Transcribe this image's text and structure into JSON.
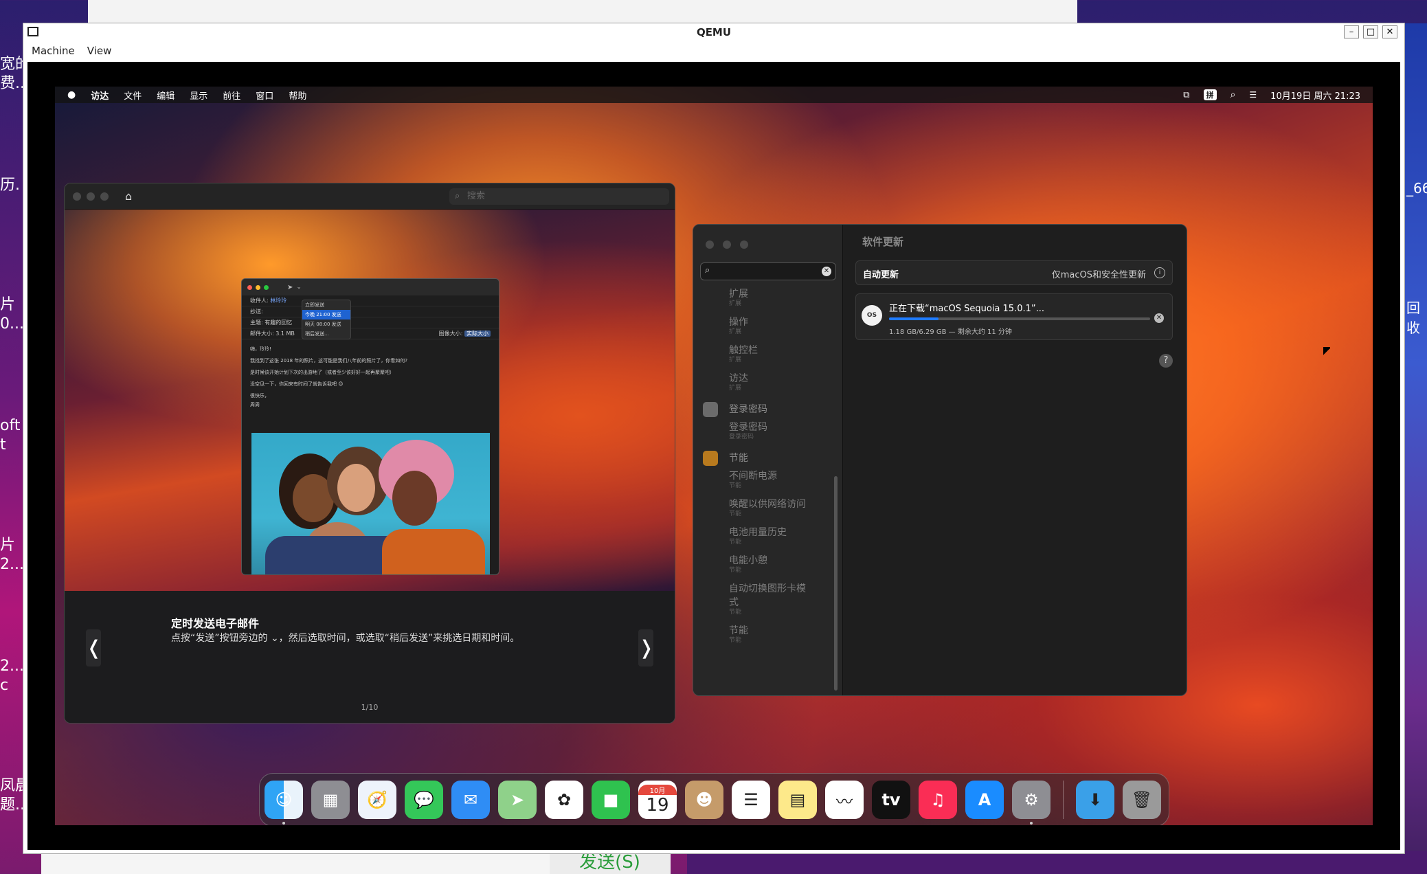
{
  "host": {
    "left_texts": [
      "宽的",
      "费...",
      "历.",
      "片",
      "0...",
      "oft",
      "t",
      "片",
      "2...",
      "2...",
      "c",
      "凤晨",
      "题..."
    ],
    "right_texts": [
      "_66",
      "回收"
    ],
    "send_button": "发送(S)"
  },
  "qemu": {
    "title": "QEMU",
    "menu": [
      "Machine",
      "View"
    ],
    "btn_min": "–",
    "btn_max": "□",
    "btn_close": "✕"
  },
  "mac": {
    "menubar": {
      "apple": "",
      "app_name": "访达",
      "items": [
        "文件",
        "编辑",
        "显示",
        "前往",
        "窗口",
        "帮助"
      ],
      "input_method": "拼",
      "datetime": "10月19日 周六 21:23"
    },
    "tips": {
      "search_placeholder": "搜索",
      "mail": {
        "to_label": "收件人:",
        "to_value": "林玲玲",
        "cc_label": "抄送:",
        "subject_label": "主题:",
        "subject_value": "有趣的回忆",
        "size_label": "邮件大小: 3.1 MB",
        "image_size_label": "图像大小:",
        "image_size_value": "实际大小",
        "menu_items": [
          "立即发送",
          "今晚 21:00 发送",
          "明天 08:00 发送",
          "稍后发送..."
        ],
        "body": [
          "嗨，玲玲!",
          "我找到了这张 2018 年的照片，这可能是我们八年前的照片了，你看如何?",
          "是时候该开始计划下次的出游地了（或者至少该好好一起再聚聚吧）",
          "没空见一下，你回来有时间了就告诉我吧 😊",
          "很快乐，",
          "周周"
        ]
      },
      "title": "定时发送电子邮件",
      "description": "点按“发送”按钮旁边的 ⌄，然后选取时间，或选取“稍后发送”来挑选日期和时间。",
      "prev": "❬",
      "next": "❭",
      "page": "1/10"
    },
    "settings": {
      "search_value": "",
      "sidebar": [
        {
          "type": "item",
          "label": "扩展",
          "sub": "扩展"
        },
        {
          "type": "item",
          "label": "操作",
          "sub": "扩展"
        },
        {
          "type": "item",
          "label": "触控栏",
          "sub": "扩展"
        },
        {
          "type": "item",
          "label": "访达",
          "sub": "扩展"
        },
        {
          "type": "head",
          "label": "登录密码",
          "color": "#6b6b6b"
        },
        {
          "type": "item",
          "label": "登录密码",
          "sub": "登录密码"
        },
        {
          "type": "head",
          "label": "节能",
          "color": "#b87a1e"
        },
        {
          "type": "item",
          "label": "不间断电源",
          "sub": "节能"
        },
        {
          "type": "item",
          "label": "唤醒以供网络访问",
          "sub": "节能"
        },
        {
          "type": "item",
          "label": "电池用量历史",
          "sub": "节能"
        },
        {
          "type": "item",
          "label": "电能小憩",
          "sub": "节能"
        },
        {
          "type": "item",
          "label": "自动切换图形卡模式",
          "sub": "节能"
        },
        {
          "type": "item",
          "label": "节能",
          "sub": "节能"
        }
      ],
      "title": "软件更新",
      "auto_update_label": "自动更新",
      "auto_update_value": "仅macOS和安全性更新",
      "download_icon_text": "OS",
      "download_title": "正在下载“macOS Sequoia 15.0.1”...",
      "download_progress": 0.19,
      "download_status": "1.18 GB/6.29 GB — 剩余大约 11 分钟"
    },
    "dock": [
      {
        "name": "finder",
        "bg": "linear-gradient(90deg,#2fa4f5 50%,#e9f3fb 50%)",
        "glyph": "☺",
        "running": true
      },
      {
        "name": "launchpad",
        "bg": "#8e8e93",
        "glyph": "▦",
        "running": false
      },
      {
        "name": "safari",
        "bg": "#eef3fb",
        "glyph": "🧭",
        "running": false
      },
      {
        "name": "messages",
        "bg": "#34c759",
        "glyph": "💬",
        "running": false
      },
      {
        "name": "mail",
        "bg": "#2f8df5",
        "glyph": "✉",
        "running": false
      },
      {
        "name": "maps",
        "bg": "#8fd18a",
        "glyph": "➤",
        "running": false
      },
      {
        "name": "photos",
        "bg": "#ffffff",
        "glyph": "✿",
        "running": false
      },
      {
        "name": "facetime",
        "bg": "#2fc24f",
        "glyph": "■",
        "running": false
      },
      {
        "name": "calendar",
        "bg": "#ffffff",
        "glyph": "19",
        "month": "10月",
        "running": false
      },
      {
        "name": "contacts",
        "bg": "#c59b6a",
        "glyph": "☻",
        "running": false
      },
      {
        "name": "reminders",
        "bg": "#ffffff",
        "glyph": "☰",
        "running": false
      },
      {
        "name": "notes",
        "bg": "#fde98a",
        "glyph": "▤",
        "running": false
      },
      {
        "name": "freeform",
        "bg": "#ffffff",
        "glyph": "〰",
        "running": false
      },
      {
        "name": "tv",
        "bg": "#111111",
        "glyph": "tv",
        "running": false
      },
      {
        "name": "music",
        "bg": "#fa2d55",
        "glyph": "♫",
        "running": false
      },
      {
        "name": "app-store",
        "bg": "#1a8cff",
        "glyph": "A",
        "running": false
      },
      {
        "name": "system-settings",
        "bg": "#8e8e93",
        "glyph": "⚙",
        "running": true
      },
      {
        "name": "downloads",
        "bg": "#3aa0e8",
        "glyph": "⬇",
        "running": false
      },
      {
        "name": "trash",
        "bg": "#9a9a9a",
        "glyph": "🗑",
        "running": false
      }
    ]
  }
}
